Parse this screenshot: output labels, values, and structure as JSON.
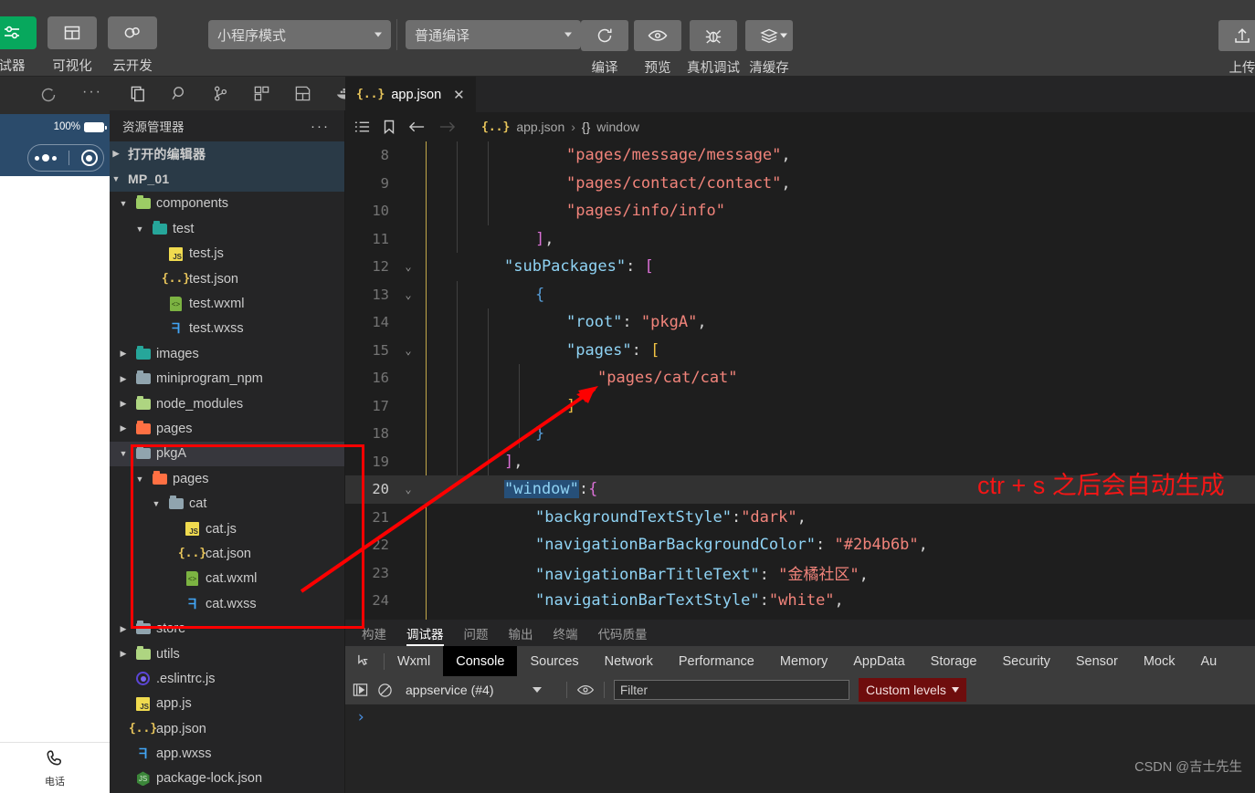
{
  "toolbar": {
    "left_buttons": [
      {
        "label": "试器",
        "icon": "simulator-icon",
        "active": true
      },
      {
        "label": "可视化",
        "icon": "visual-layout-icon",
        "active": false
      },
      {
        "label": "云开发",
        "icon": "cloud-dev-icon",
        "active": false
      }
    ],
    "mode_select": {
      "value": "小程序模式",
      "icon": "chevron-down-icon"
    },
    "compile_select": {
      "value": "普通编译",
      "icon": "chevron-down-icon"
    },
    "actions": [
      {
        "label": "编译",
        "icon": "refresh-icon"
      },
      {
        "label": "预览",
        "icon": "eye-icon"
      },
      {
        "label": "真机调试",
        "icon": "bug-icon"
      },
      {
        "label": "清缓存",
        "icon": "layers-icon"
      }
    ],
    "upload": {
      "label": "上传",
      "icon": "upload-icon"
    }
  },
  "simulator": {
    "refresh_icon": "refresh-icon",
    "more_icon": "more-horizontal-icon",
    "status": {
      "battery": "100%"
    },
    "capsule": {
      "menu_icon": "capsule-menu-icon",
      "target_icon": "capsule-target-icon"
    },
    "tabbar": [
      {
        "icon": "phone-icon",
        "label": "电话"
      }
    ]
  },
  "activitybar": {
    "icons": [
      "explorer-files-icon",
      "search-icon",
      "source-control-icon",
      "extensions-icon",
      "structure-icon",
      "docker-icon"
    ]
  },
  "explorer": {
    "title": "资源管理器",
    "more_icon": "more-horizontal-icon",
    "open_editors": {
      "label": "打开的编辑器",
      "expanded": false
    },
    "project": {
      "label": "MP_01",
      "expanded": true
    },
    "tree": [
      {
        "label": "components",
        "kind": "folder-green",
        "depth": 1,
        "twisty": "down"
      },
      {
        "label": "test",
        "kind": "folder-teal",
        "depth": 2,
        "twisty": "down"
      },
      {
        "label": "test.js",
        "kind": "js",
        "depth": 3,
        "twisty": "none"
      },
      {
        "label": "test.json",
        "kind": "json",
        "depth": 3,
        "twisty": "none"
      },
      {
        "label": "test.wxml",
        "kind": "wxml",
        "depth": 3,
        "twisty": "none"
      },
      {
        "label": "test.wxss",
        "kind": "wxss",
        "depth": 3,
        "twisty": "none"
      },
      {
        "label": "images",
        "kind": "folder-teal",
        "depth": 1,
        "twisty": "right"
      },
      {
        "label": "miniprogram_npm",
        "kind": "folder-grey",
        "depth": 1,
        "twisty": "right"
      },
      {
        "label": "node_modules",
        "kind": "folder-lime",
        "depth": 1,
        "twisty": "right"
      },
      {
        "label": "pages",
        "kind": "folder-orange",
        "depth": 1,
        "twisty": "right"
      },
      {
        "label": "pkgA",
        "kind": "folder-grey",
        "depth": 1,
        "twisty": "down",
        "selected": true
      },
      {
        "label": "pages",
        "kind": "folder-orange",
        "depth": 2,
        "twisty": "down"
      },
      {
        "label": "cat",
        "kind": "folder-grey",
        "depth": 3,
        "twisty": "down"
      },
      {
        "label": "cat.js",
        "kind": "js",
        "depth": 4,
        "twisty": "none"
      },
      {
        "label": "cat.json",
        "kind": "json",
        "depth": 4,
        "twisty": "none"
      },
      {
        "label": "cat.wxml",
        "kind": "wxml",
        "depth": 4,
        "twisty": "none"
      },
      {
        "label": "cat.wxss",
        "kind": "wxss",
        "depth": 4,
        "twisty": "none"
      },
      {
        "label": "store",
        "kind": "folder-grey",
        "depth": 1,
        "twisty": "right"
      },
      {
        "label": "utils",
        "kind": "folder-lime",
        "depth": 1,
        "twisty": "right"
      },
      {
        "label": ".eslintrc.js",
        "kind": "eslint",
        "depth": 1,
        "twisty": "none"
      },
      {
        "label": "app.js",
        "kind": "js",
        "depth": 1,
        "twisty": "none"
      },
      {
        "label": "app.json",
        "kind": "json",
        "depth": 1,
        "twisty": "none"
      },
      {
        "label": "app.wxss",
        "kind": "wxss",
        "depth": 1,
        "twisty": "none"
      },
      {
        "label": "package-lock.json",
        "kind": "node",
        "depth": 1,
        "twisty": "none"
      }
    ]
  },
  "editor": {
    "tab": {
      "label": "app.json",
      "icon": "json-icon",
      "close_icon": "close-icon"
    },
    "breadcrumb_icons": [
      "outline-icon",
      "bookmark-icon",
      "arrow-left-icon",
      "arrow-right-icon"
    ],
    "breadcrumb": {
      "file_icon": "json-icon",
      "file": "app.json",
      "sep": "›",
      "symbol_icon": "{}",
      "symbol": "window"
    },
    "annotation": "ctr + s 之后会自动生成",
    "annotation_color": "#f31616",
    "code": [
      {
        "n": "8",
        "fold": "",
        "indent": 6,
        "html": "<span class=\"tk-str\">\"pages/message/message\"</span><span class=\"tk-pun\">,</span>"
      },
      {
        "n": "9",
        "fold": "",
        "indent": 6,
        "html": "<span class=\"tk-str\">\"pages/contact/contact\"</span><span class=\"tk-pun\">,</span>"
      },
      {
        "n": "10",
        "fold": "",
        "indent": 6,
        "html": "<span class=\"tk-str\">\"pages/info/info\"</span>"
      },
      {
        "n": "11",
        "fold": "",
        "indent": 4,
        "html": "<span class=\"tk-br2\">]</span><span class=\"tk-pun\">,</span>"
      },
      {
        "n": "12",
        "fold": "v",
        "indent": 2,
        "html": "<span class=\"tk-key\">\"subPackages\"</span><span class=\"tk-pun\">: </span><span class=\"tk-br2\">[</span>"
      },
      {
        "n": "13",
        "fold": "v",
        "indent": 4,
        "html": "<span class=\"tk-br3\">{</span>"
      },
      {
        "n": "14",
        "fold": "",
        "indent": 6,
        "html": "<span class=\"tk-key\">\"root\"</span><span class=\"tk-pun\">: </span><span class=\"tk-str\">\"pkgA\"</span><span class=\"tk-pun\">,</span>"
      },
      {
        "n": "15",
        "fold": "v",
        "indent": 6,
        "html": "<span class=\"tk-key\">\"pages\"</span><span class=\"tk-pun\">: </span><span class=\"tk-br1\">[</span>"
      },
      {
        "n": "16",
        "fold": "",
        "indent": 8,
        "html": "<span class=\"tk-str\">\"pages/cat/cat\"</span>"
      },
      {
        "n": "17",
        "fold": "",
        "indent": 6,
        "html": "<span class=\"tk-br1\">]</span>"
      },
      {
        "n": "18",
        "fold": "",
        "indent": 4,
        "html": "<span class=\"tk-br3\">}</span>"
      },
      {
        "n": "19",
        "fold": "",
        "indent": 2,
        "html": "<span class=\"tk-br2\">]</span><span class=\"tk-pun\">,</span>"
      },
      {
        "n": "20",
        "fold": "v",
        "indent": 2,
        "cur": true,
        "html": "<span class=\"hl-sel tk-key\">\"window\"</span><span class=\"tk-pun\">:</span><span class=\"tk-br2\">{</span>"
      },
      {
        "n": "21",
        "fold": "",
        "indent": 4,
        "html": "<span class=\"tk-key\">\"backgroundTextStyle\"</span><span class=\"tk-pun\">:</span><span class=\"tk-str\">\"dark\"</span><span class=\"tk-pun\">,</span>"
      },
      {
        "n": "22",
        "fold": "",
        "indent": 4,
        "html": "<span class=\"tk-key\">\"navigationBarBackgroundColor\"</span><span class=\"tk-pun\">: </span><span class=\"tk-str\">\"#2b4b6b\"</span><span class=\"tk-pun\">,</span>"
      },
      {
        "n": "23",
        "fold": "",
        "indent": 4,
        "html": "<span class=\"tk-key\">\"navigationBarTitleText\"</span><span class=\"tk-pun\">: </span><span class=\"tk-str\">\"金橘社区\"</span><span class=\"tk-pun\">,</span>"
      },
      {
        "n": "24",
        "fold": "",
        "indent": 4,
        "html": "<span class=\"tk-key\">\"navigationBarTextStyle\"</span><span class=\"tk-pun\">:</span><span class=\"tk-str\">\"white\"</span><span class=\"tk-pun\">,</span>"
      }
    ]
  },
  "panel": {
    "tabs": [
      {
        "label": "构建",
        "active": false
      },
      {
        "label": "调试器",
        "active": true
      },
      {
        "label": "问题",
        "active": false
      },
      {
        "label": "输出",
        "active": false
      },
      {
        "label": "终端",
        "active": false
      },
      {
        "label": "代码质量",
        "active": false
      }
    ],
    "devtools": {
      "inspect_icon": "inspect-element-icon",
      "tabs": [
        {
          "label": "Wxml",
          "active": false
        },
        {
          "label": "Console",
          "active": true
        },
        {
          "label": "Sources",
          "active": false
        },
        {
          "label": "Network",
          "active": false
        },
        {
          "label": "Performance",
          "active": false
        },
        {
          "label": "Memory",
          "active": false
        },
        {
          "label": "AppData",
          "active": false
        },
        {
          "label": "Storage",
          "active": false
        },
        {
          "label": "Security",
          "active": false
        },
        {
          "label": "Sensor",
          "active": false
        },
        {
          "label": "Mock",
          "active": false
        },
        {
          "label": "Au",
          "active": false
        }
      ]
    },
    "console": {
      "execute_icon": "execute-icon",
      "clear_icon": "clear-console-icon",
      "context": "appservice (#4)",
      "eye_icon": "eye-icon",
      "filter_placeholder": "Filter",
      "filter_value": "",
      "levels": "Custom levels",
      "prompt": "›"
    }
  },
  "watermark": "CSDN @吉士先生",
  "colors": {
    "accent_green": "#07a85d",
    "annotation_red": "#fe0000",
    "nav_blue": "#2b4b6b",
    "string_red": "#f2847b",
    "key_blue": "#8fd3f4"
  }
}
